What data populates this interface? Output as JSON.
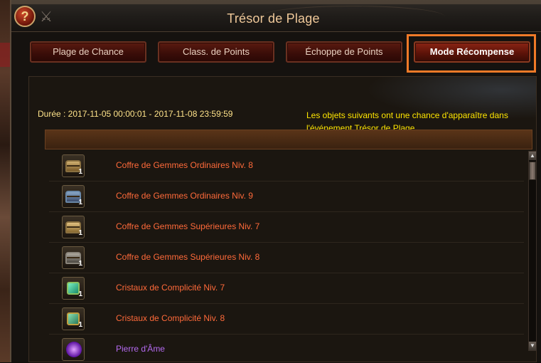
{
  "window": {
    "title": "Trésor de Plage",
    "help_label": "?"
  },
  "tabs": [
    {
      "label": "Plage de Chance",
      "active": false
    },
    {
      "label": "Class. de Points",
      "active": false
    },
    {
      "label": "Échoppe de Points",
      "active": false
    },
    {
      "label": "Mode Récompense",
      "active": true
    }
  ],
  "info": {
    "duration": "Durée : 2017-11-05 00:00:01 - 2017-11-08 23:59:59",
    "note": "Les objets suivants ont une chance d'apparaître dans l'événement Trésor de Plage."
  },
  "rewards": [
    {
      "name": "Coffre de Gemmes Ordinaires Niv. 8",
      "qty": "1",
      "icon": "gold-chest-icon"
    },
    {
      "name": "Coffre de Gemmes Ordinaires Niv. 9",
      "qty": "1",
      "icon": "blue-chest-icon"
    },
    {
      "name": "Coffre de Gemmes Supérieures Niv. 7",
      "qty": "1",
      "icon": "gold-chest-icon"
    },
    {
      "name": "Coffre de Gemmes Supérieures Niv. 8",
      "qty": "1",
      "icon": "silver-chest-icon"
    },
    {
      "name": "Cristaux de Complicité Niv. 7",
      "qty": "1",
      "icon": "green-crystal-icon"
    },
    {
      "name": "Cristaux de Complicité Niv. 8",
      "qty": "1",
      "icon": "green-crystal-icon"
    },
    {
      "name": "Pierre d'Âme",
      "qty": "",
      "icon": "purple-orb-icon"
    }
  ],
  "colors": {
    "accent_highlight": "#f07a28",
    "item_text": "#ff6a3a",
    "soul_text": "#b46af0",
    "note_text": "#ffe600"
  }
}
